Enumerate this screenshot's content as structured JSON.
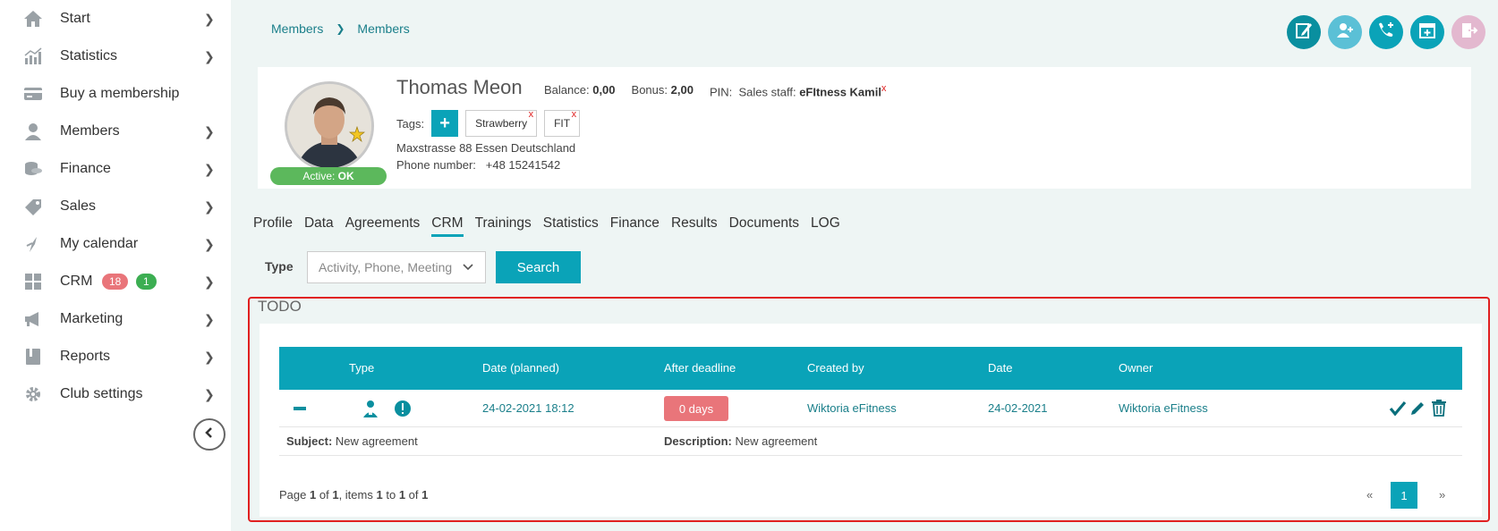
{
  "sidebar": {
    "items": [
      {
        "label": "Start",
        "icon": "home-icon"
      },
      {
        "label": "Statistics",
        "icon": "chart-icon"
      },
      {
        "label": "Buy a membership",
        "icon": "card-icon"
      },
      {
        "label": "Members",
        "icon": "user-icon"
      },
      {
        "label": "Finance",
        "icon": "coins-icon"
      },
      {
        "label": "Sales",
        "icon": "tag-icon"
      },
      {
        "label": "My calendar",
        "icon": "calendar-icon"
      },
      {
        "label": "CRM",
        "icon": "grid-icon"
      },
      {
        "label": "Marketing",
        "icon": "megaphone-icon"
      },
      {
        "label": "Reports",
        "icon": "book-icon"
      },
      {
        "label": "Club settings",
        "icon": "gear-icon"
      }
    ],
    "crm_badge_red": "18",
    "crm_badge_green": "1"
  },
  "breadcrumb": [
    "Members",
    "Members"
  ],
  "member": {
    "name": "Thomas Meon",
    "balance_label": "Balance:",
    "balance_value": "0,00",
    "bonus_label": "Bonus:",
    "bonus_value": "2,00",
    "pin_label": "PIN:",
    "staff_label": "Sales staff:",
    "staff_value": "eFItness Kamil",
    "staff_remove": "x",
    "status_label": "Active:",
    "status_value": "OK",
    "tags_label": "Tags:",
    "tag_add": "+",
    "tags": [
      "Strawberry",
      "FIT"
    ],
    "tag_remove": "x",
    "address": "Maxstrasse 88 Essen Deutschland",
    "phone_label": "Phone number:",
    "phone_value": "+48 15241542"
  },
  "tabs": [
    "Profile",
    "Data",
    "Agreements",
    "CRM",
    "Trainings",
    "Statistics",
    "Finance",
    "Results",
    "Documents",
    "LOG"
  ],
  "active_tab": "CRM",
  "filter": {
    "type_label": "Type",
    "type_placeholder": "Activity, Phone, Meeting",
    "search_label": "Search"
  },
  "todo": {
    "title": "TODO",
    "columns": [
      "Type",
      "Date (planned)",
      "After deadline",
      "Created by",
      "Date",
      "Owner"
    ],
    "row": {
      "date_planned": "24-02-2021 18:12",
      "after_deadline": "0 days",
      "created_by": "Wiktoria eFitness",
      "date": "24-02-2021",
      "owner": "Wiktoria eFitness",
      "subject_label": "Subject:",
      "subject_value": "New agreement",
      "description_label": "Description:",
      "description_value": "New agreement"
    },
    "pager": {
      "page_word": "Page",
      "page": "1",
      "of_word": "of",
      "pages": "1",
      "items_word": ", items",
      "from": "1",
      "to_word": "to",
      "to": "1",
      "total": "1",
      "prev": "«",
      "next": "»",
      "current": "1"
    }
  },
  "colors": {
    "accent": "#0aa3b8",
    "danger": "#e9757a",
    "success": "#5cb85c",
    "highlight": "#e02020"
  }
}
